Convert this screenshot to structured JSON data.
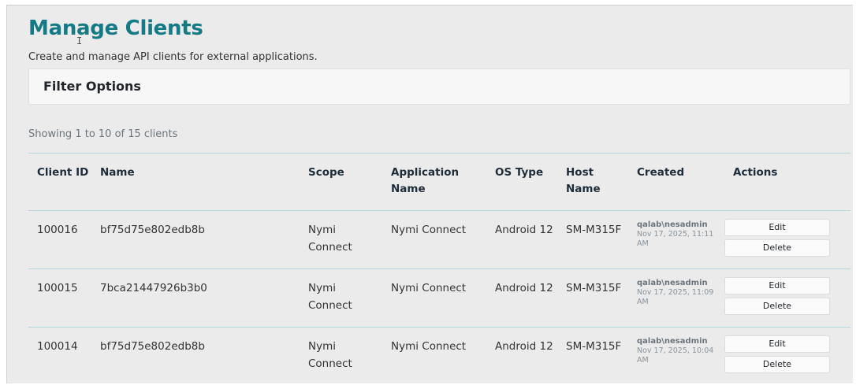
{
  "page": {
    "title": "Manage Clients",
    "subtitle": "Create and manage API clients for external applications."
  },
  "filter": {
    "title": "Filter Options"
  },
  "summary": {
    "showing": "Showing 1 to 10 of 15 clients"
  },
  "table": {
    "headers": [
      "Client ID",
      "Name",
      "Scope",
      "Application Name",
      "OS Type",
      "Host Name",
      "Created",
      "Actions"
    ],
    "edit_label": "Edit",
    "delete_label": "Delete",
    "rows": [
      {
        "client_id": "100016",
        "name": "bf75d75e802edb8b",
        "scope": "Nymi Connect",
        "app_name": "Nymi Connect",
        "os_type": "Android 12",
        "host": "SM-M315F",
        "created_by": "qalab\\nesadmin",
        "created_at": "Nov 17, 2025, 11:11 AM"
      },
      {
        "client_id": "100015",
        "name": "7bca21447926b3b0",
        "scope": "Nymi Connect",
        "app_name": "Nymi Connect",
        "os_type": "Android 12",
        "host": "SM-M315F",
        "created_by": "qalab\\nesadmin",
        "created_at": "Nov 17, 2025, 11:09 AM"
      },
      {
        "client_id": "100014",
        "name": "bf75d75e802edb8b",
        "scope": "Nymi Connect",
        "app_name": "Nymi Connect",
        "os_type": "Android 12",
        "host": "SM-M315F",
        "created_by": "qalab\\nesadmin",
        "created_at": "Nov 17, 2025, 10:04 AM"
      }
    ]
  }
}
